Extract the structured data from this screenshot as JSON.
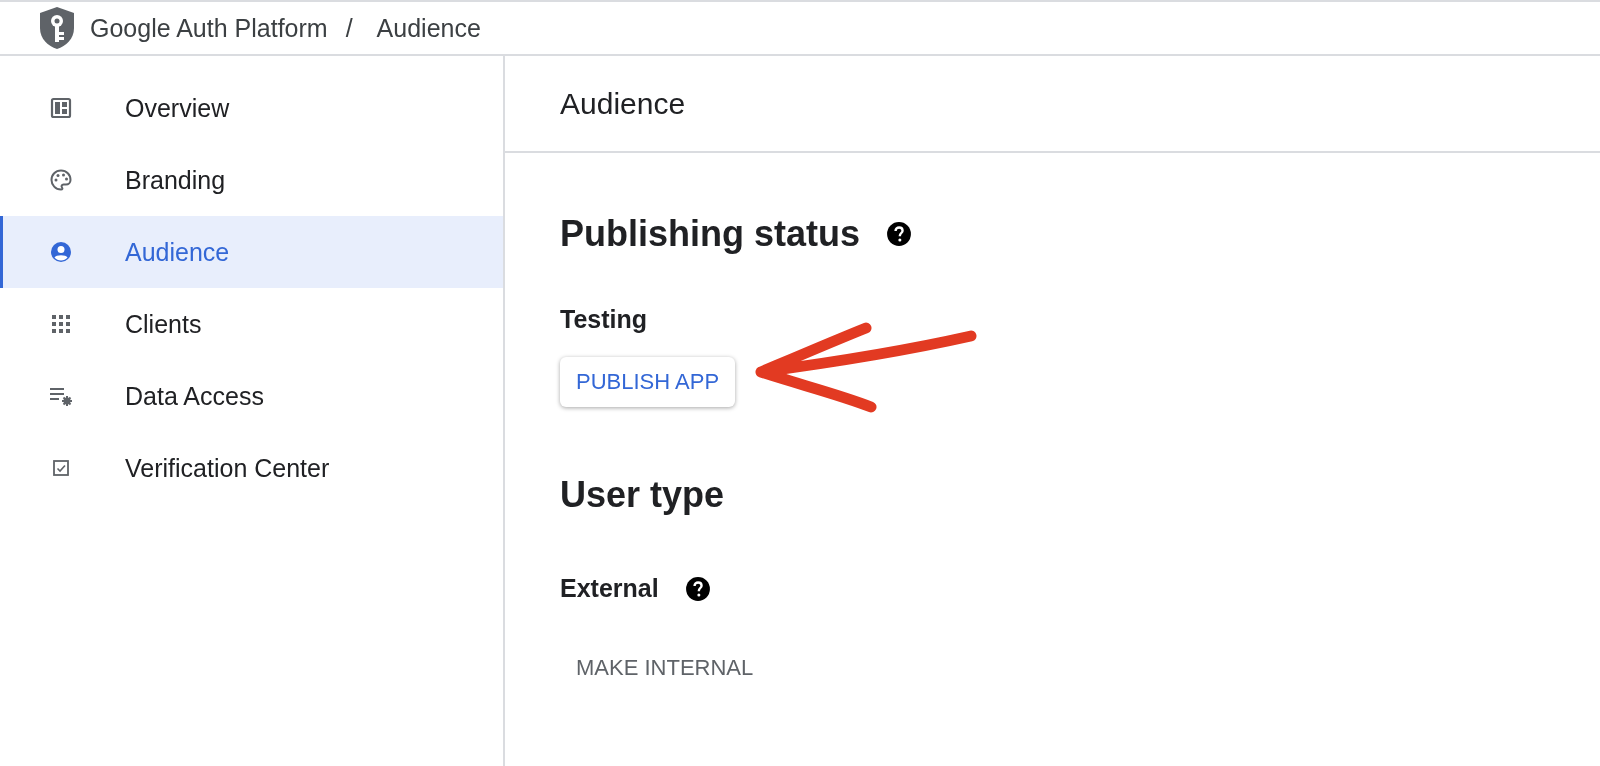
{
  "breadcrumb": {
    "product": "Google Auth Platform",
    "separator": "/",
    "page": "Audience"
  },
  "sidebar": {
    "items": [
      {
        "kind": "overview",
        "label": "Overview",
        "selected": false
      },
      {
        "kind": "branding",
        "label": "Branding",
        "selected": false
      },
      {
        "kind": "audience",
        "label": "Audience",
        "selected": true
      },
      {
        "kind": "clients",
        "label": "Clients",
        "selected": false
      },
      {
        "kind": "data-access",
        "label": "Data Access",
        "selected": false
      },
      {
        "kind": "verification",
        "label": "Verification Center",
        "selected": false
      }
    ]
  },
  "main": {
    "title": "Audience",
    "publishing_status": {
      "heading": "Publishing status",
      "status": "Testing",
      "button": "PUBLISH APP"
    },
    "user_type": {
      "heading": "User type",
      "type": "External",
      "button": "MAKE INTERNAL"
    }
  }
}
